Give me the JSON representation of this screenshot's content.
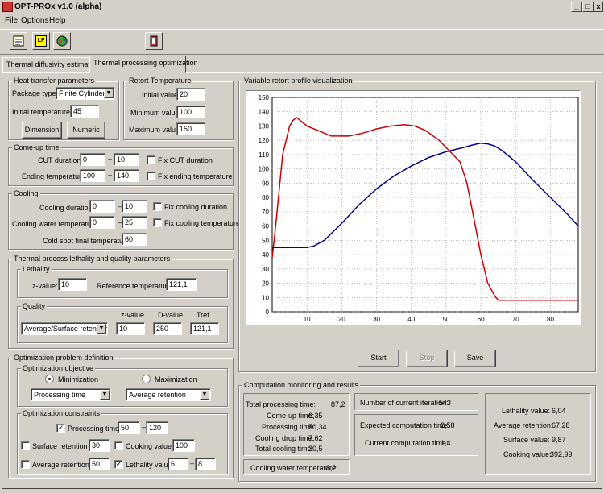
{
  "window": {
    "title": "OPT-PROx  v1.0 (alpha)",
    "min": "_",
    "max": "□",
    "close": "x",
    "restore": "̲"
  },
  "menu": {
    "file": "File",
    "options": "Options",
    "help": "Help"
  },
  "toolbar": {
    "icons": [
      "report-icon",
      "lf-icon",
      "globe-icon",
      "exit-icon"
    ],
    "lf_label": "LF"
  },
  "tabs": [
    {
      "label": "Thermal diffusivity estimation"
    },
    {
      "label": "Thermal processing optimization"
    }
  ],
  "heat_transfer": {
    "title": "Heat transfer parameters",
    "package_type_label": "Package type:",
    "package_type_value": "Finite Cylinder (c",
    "initial_temp_label": "Initial temperature:",
    "initial_temp_value": "45",
    "dimension_btn": "Dimension",
    "numeric_btn": "Numeric"
  },
  "retort": {
    "title": "Retort Temperature",
    "initial_label": "Initial value:",
    "initial_value": "20",
    "min_label": "Minimum value:",
    "min_value": "100",
    "max_label": "Maximum value:",
    "max_value": "150"
  },
  "come_up": {
    "title": "Come-up time",
    "cut_label": "CUT duration:",
    "cut_from": "0",
    "cut_to": "10",
    "fix_cut_label": "Fix CUT duration",
    "end_temp_label": "Ending temperature:",
    "end_from": "100",
    "end_to": "140",
    "fix_end_label": "Fix ending temperature",
    "dash": "–"
  },
  "cooling": {
    "title": "Cooling",
    "duration_label": "Cooling duration:",
    "duration_from": "0",
    "duration_to": "10",
    "fix_duration_label": "Fix cooling duration",
    "water_label": "Cooling water temperature:",
    "water_from": "0",
    "water_to": "25",
    "fix_temp_label": "Fix cooling temperature",
    "final_label": "Cold spot final temperature:",
    "final_value": "60"
  },
  "lethality_quality": {
    "title": "Thermal process lethality and quality parameters",
    "lethality_title": "Lethality",
    "zvalue_label": "z-value:",
    "zvalue": "10",
    "ref_label": "Reference temperature:",
    "ref_value": "121,1",
    "quality_title": "Quality",
    "quality_select": "Average/Surface retention",
    "q_z_label": "z-value",
    "q_d_label": "D-value",
    "q_t_label": "Tref",
    "q_z": "10",
    "q_d": "250",
    "q_t": "121,1"
  },
  "optimization": {
    "title": "Optimization problem definition",
    "objective_title": "Optimization objective",
    "minimization": "Minimization",
    "maximization": "Maximization",
    "min_select": "Processing time",
    "max_select": "Average retention",
    "constraints_title": "Optimization constraints",
    "proc_time_label": "Processing time:",
    "proc_from": "50",
    "proc_to": "120",
    "surface_label": "Surface retention >",
    "surface_value": "30",
    "cooking_label": "Cooking value <",
    "cooking_value": "100",
    "avg_label": "Average retention >",
    "avg_value": "50",
    "leth_label": "Lethality value:",
    "leth_from": "6",
    "leth_to": "8",
    "check": "✓"
  },
  "plot": {
    "title": "Variable retort profile visualization",
    "start": "Start",
    "stop": "Stop",
    "save": "Save"
  },
  "chart_data": {
    "type": "line",
    "title": "",
    "xlabel": "",
    "ylabel": "",
    "xlim": [
      0,
      88
    ],
    "ylim": [
      0,
      150
    ],
    "xticks": [
      10,
      20,
      30,
      40,
      50,
      60,
      70,
      80
    ],
    "yticks": [
      0,
      10,
      20,
      30,
      40,
      50,
      60,
      70,
      80,
      90,
      100,
      110,
      120,
      130,
      140,
      150
    ],
    "grid": true,
    "series": [
      {
        "color": "#cc0000",
        "x": [
          0,
          1,
          3,
          5,
          6,
          7,
          10,
          14,
          17,
          22,
          26,
          30,
          34,
          38,
          41,
          44,
          48,
          50,
          52,
          54,
          56,
          58,
          60,
          62,
          64,
          65,
          70,
          80,
          88
        ],
        "y": [
          38,
          60,
          110,
          130,
          134,
          136,
          130,
          126,
          123,
          123,
          125,
          128,
          130,
          131,
          130,
          127,
          120,
          115,
          110,
          105,
          90,
          65,
          40,
          20,
          11,
          8,
          8,
          8,
          8
        ]
      },
      {
        "color": "#000099",
        "x": [
          0,
          2,
          4,
          6,
          8,
          10,
          12,
          15,
          20,
          25,
          30,
          35,
          40,
          45,
          50,
          55,
          58,
          60,
          62,
          64,
          66,
          70,
          75,
          80,
          85,
          88
        ],
        "y": [
          45,
          45,
          45,
          45,
          45,
          45,
          46,
          50,
          62,
          75,
          86,
          95,
          102,
          108,
          112,
          115,
          117,
          118,
          117.5,
          116,
          113,
          105,
          92,
          80,
          68,
          60
        ]
      }
    ]
  },
  "monitor": {
    "title": "Computation monitoring and results",
    "total_proc_label": "Total processing time:",
    "total_proc": "87,2",
    "cut_label": "Come-up time:",
    "cut": "6,35",
    "proc_label": "Processing time:",
    "proc": "50,34",
    "drop_label": "Cooling drop time:",
    "drop": "7,62",
    "total_cool_label": "Total cooling time:",
    "total_cool": "30,5",
    "water_label": "Cooling water temperature:",
    "water": "8,2",
    "iter_label": "Number of current iteration:",
    "iter": "543",
    "expected_label": "Expected computation time:",
    "expected": "2,58",
    "current_label": "Current computation time:",
    "current": "1,4",
    "leth_label": "Lethality value:",
    "leth": "6,04",
    "avg_label": "Average retention:",
    "avg": "67,28",
    "surf_label": "Surface value:",
    "surf": "9,87",
    "cook_label": "Cooking value:",
    "cook": "392,99"
  }
}
